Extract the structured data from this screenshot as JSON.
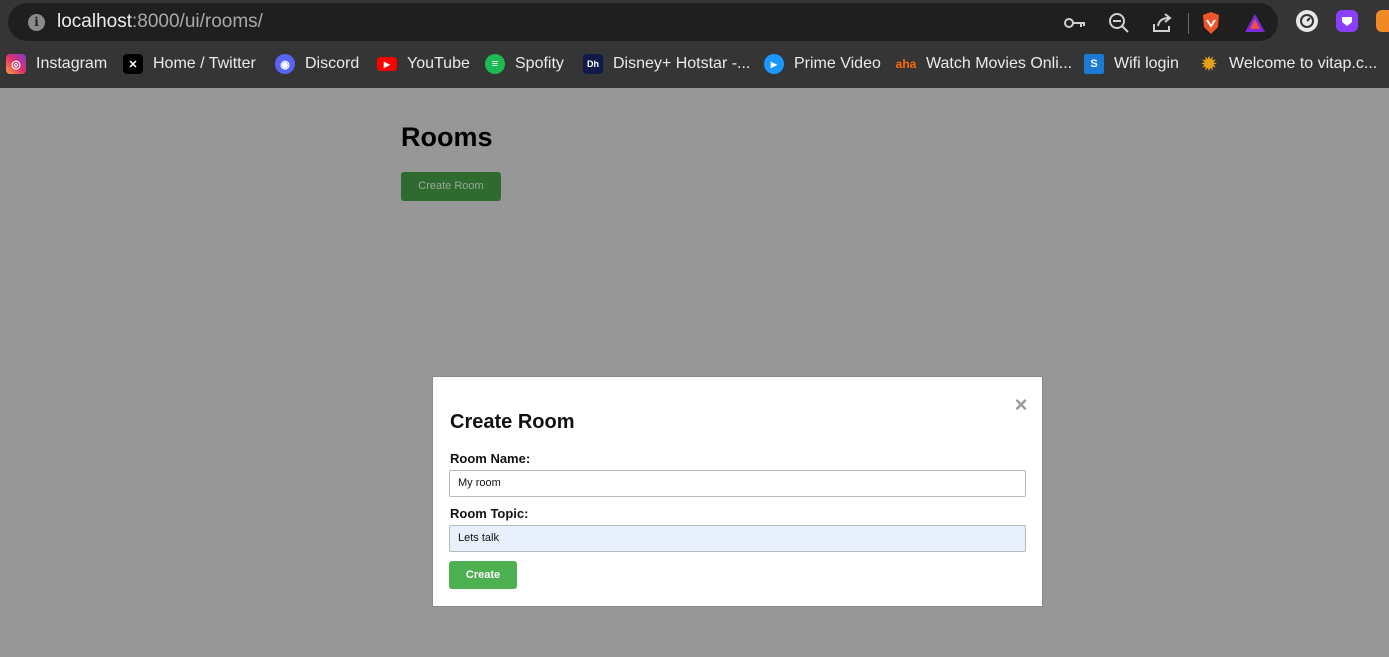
{
  "browser": {
    "url_host": "localhost",
    "url_path": ":8000/ui/rooms/",
    "bookmarks": [
      {
        "label": "Instagram",
        "icon": "instagram-icon",
        "color": "#e1306c"
      },
      {
        "label": "Home / Twitter",
        "icon": "x-twitter-icon",
        "color": "#000000"
      },
      {
        "label": "Discord",
        "icon": "discord-icon",
        "color": "#5865f2"
      },
      {
        "label": "YouTube",
        "icon": "youtube-icon",
        "color": "#ff0000"
      },
      {
        "label": "Spofity",
        "icon": "spotify-icon",
        "color": "#1db954"
      },
      {
        "label": "Disney+ Hotstar -...",
        "icon": "hotstar-icon",
        "color": "#0f1a4a"
      },
      {
        "label": "Prime Video",
        "icon": "prime-video-icon",
        "color": "#1a98ff"
      },
      {
        "label": "Watch Movies Onli...",
        "icon": "aha-icon",
        "color": "#ff6a00"
      },
      {
        "label": "Wifi login",
        "icon": "wifi-login-icon",
        "color": "#1a7ad4"
      },
      {
        "label": "Welcome to vitap.c...",
        "icon": "vitap-icon",
        "color": "#e8a21a"
      }
    ]
  },
  "page": {
    "title": "Rooms",
    "create_button": "Create Room"
  },
  "modal": {
    "title": "Create Room",
    "close_symbol": "×",
    "room_name_label": "Room Name:",
    "room_name_value": "My room",
    "room_topic_label": "Room Topic:",
    "room_topic_value": "Lets talk",
    "submit_label": "Create"
  },
  "colors": {
    "overlay": "#979797",
    "primary_button": "#4caf50",
    "dimmed_button": "#2f6b2f",
    "autofill_bg": "#e8f0fe"
  }
}
